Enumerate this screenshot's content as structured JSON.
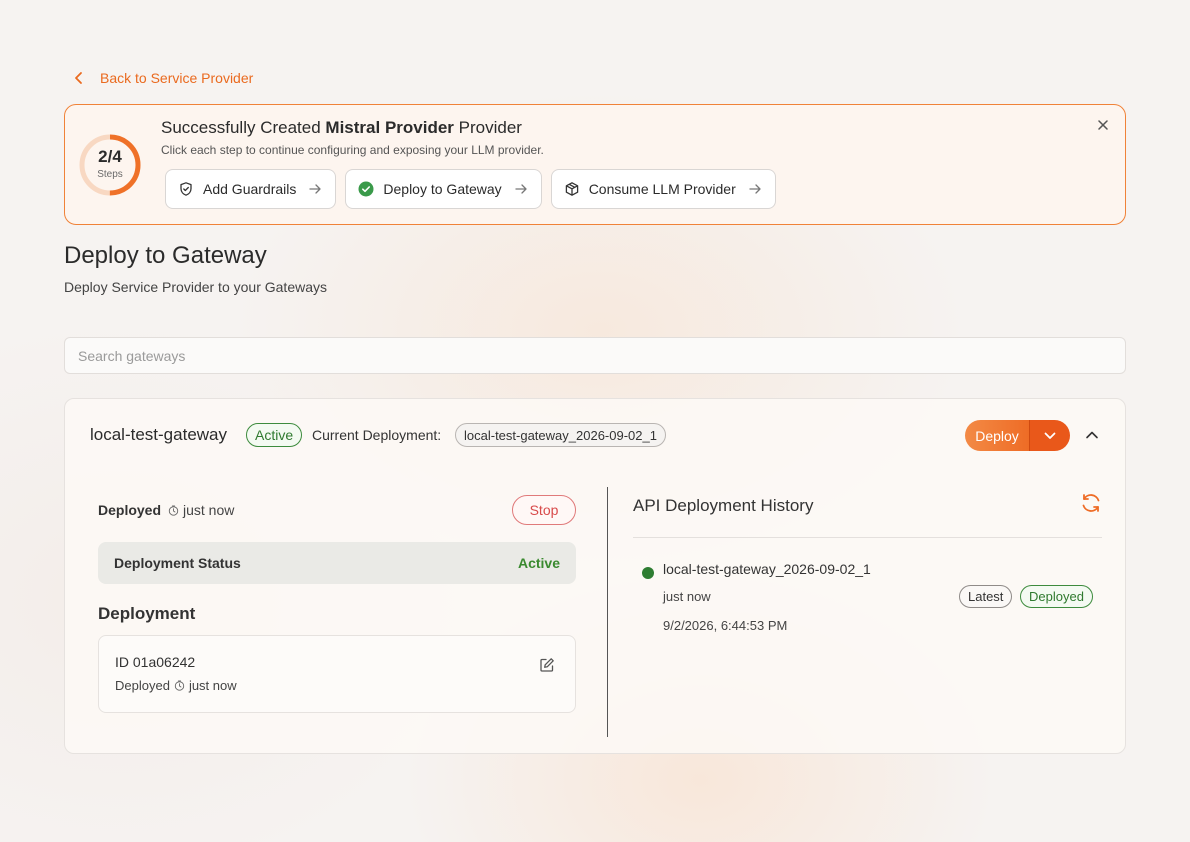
{
  "back_link": {
    "label": "Back to Service Provider"
  },
  "banner": {
    "progress": {
      "count": "2/4",
      "label": "Steps",
      "done": 2,
      "total": 4
    },
    "title_prefix": "Successfully Created",
    "title_name": "Mistral Provider",
    "title_suffix": "Provider",
    "subtitle": "Click each step to continue configuring and exposing your LLM provider.",
    "steps": [
      {
        "label": "Add Guardrails",
        "icon": "shield-icon",
        "completed": false
      },
      {
        "label": "Deploy to Gateway",
        "icon": "check-circle-icon",
        "completed": true
      },
      {
        "label": "Consume LLM Provider",
        "icon": "package-icon",
        "completed": false
      }
    ]
  },
  "page": {
    "title": "Deploy to Gateway",
    "subtitle": "Deploy Service Provider to your Gateways"
  },
  "search": {
    "placeholder": "Search gateways",
    "value": ""
  },
  "gateway": {
    "name": "local-test-gateway",
    "status": "Active",
    "current_deployment_label": "Current Deployment:",
    "current_deployment": "local-test-gateway_2026-09-02_1",
    "deploy_label": "Deploy",
    "deployed_label": "Deployed",
    "deployed_time": "just now",
    "stop_label": "Stop",
    "status_box": {
      "label": "Deployment Status",
      "value": "Active"
    },
    "deployment_heading": "Deployment",
    "deployment_card": {
      "id": "ID 01a06242",
      "deployed_label": "Deployed",
      "deployed_time": "just now"
    },
    "history": {
      "title": "API Deployment History",
      "entries": [
        {
          "name": "local-test-gateway_2026-09-02_1",
          "when": "just now",
          "date": "9/2/2026, 6:44:53 PM",
          "tags": [
            "Latest",
            "Deployed"
          ]
        }
      ]
    }
  },
  "colors": {
    "accent": "#ee6c26",
    "active_green": "#2e7d32",
    "stop_red": "#d84a4a"
  }
}
